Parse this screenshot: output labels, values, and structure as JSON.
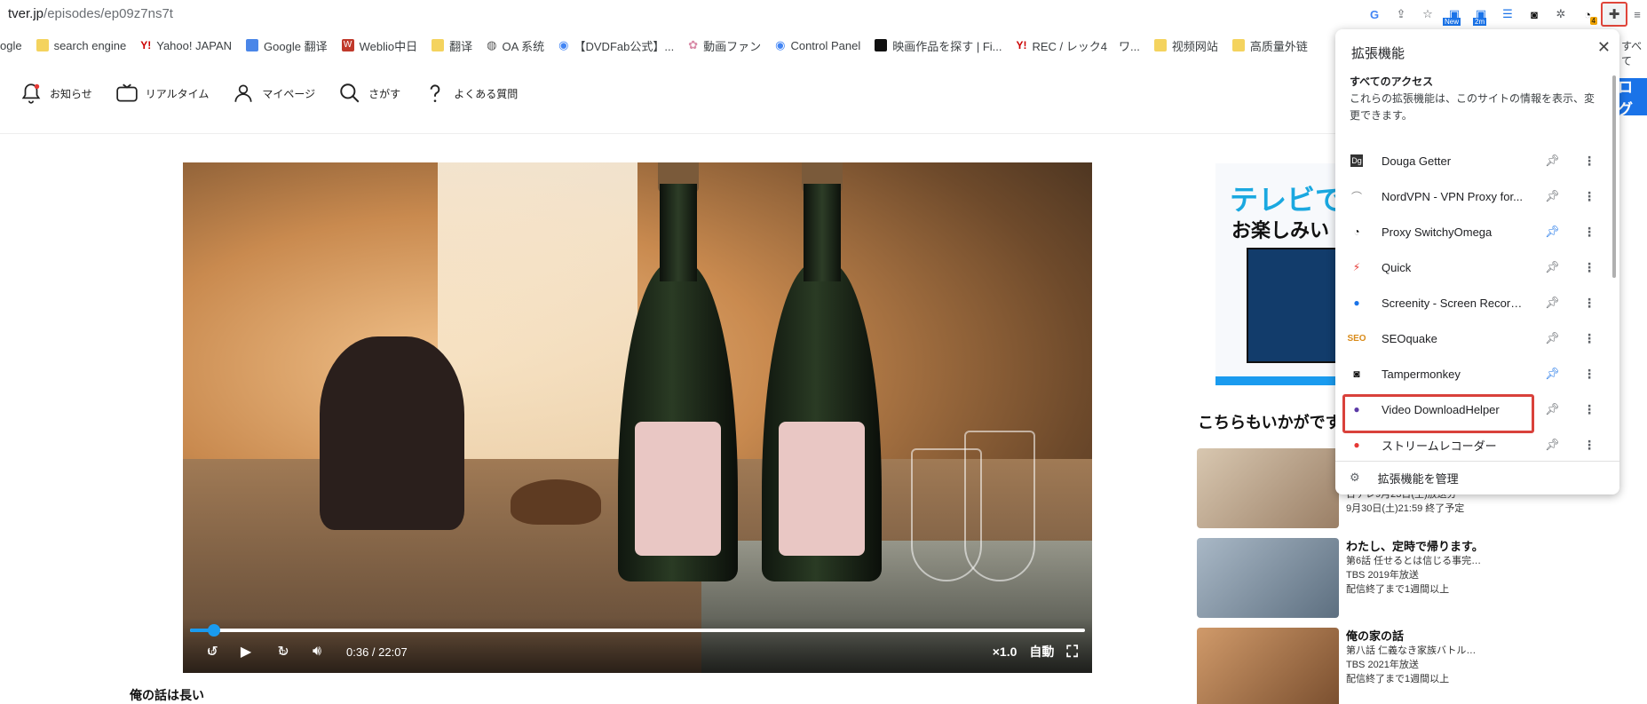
{
  "browser": {
    "url_host": "tver.jp",
    "url_path": "/episodes/ep09z7ns7t",
    "bookmarks": [
      {
        "label": "ogle",
        "icon": "partial"
      },
      {
        "label": "search engine",
        "icon": "folder-icon"
      },
      {
        "label": "Yahoo! JAPAN",
        "icon": "yahoo-icon"
      },
      {
        "label": "Google 翻译",
        "icon": "translate-icon"
      },
      {
        "label": "Weblio中日",
        "icon": "weblio-icon"
      },
      {
        "label": "翻译",
        "icon": "folder-icon"
      },
      {
        "label": "OA 系统",
        "icon": "globe-icon"
      },
      {
        "label": "【DVDFab公式】...",
        "icon": "chrome-icon"
      },
      {
        "label": "動画ファン",
        "icon": "flower-icon"
      },
      {
        "label": "Control Panel",
        "icon": "chrome-icon"
      },
      {
        "label": "映画作品を探す | Fi...",
        "icon": "film-icon"
      },
      {
        "label": "REC / レック4　ワ...",
        "icon": "yahoo-icon"
      },
      {
        "label": "视频网站",
        "icon": "folder-icon"
      },
      {
        "label": "高质量外链",
        "icon": "folder-icon"
      }
    ],
    "bookmarks_overflow": "すべて",
    "toolbar_badges": {
      "new": "New",
      "two_m": "2m",
      "count": "4"
    }
  },
  "site": {
    "nav": [
      {
        "label": "お知らせ",
        "icon": "bell-icon"
      },
      {
        "label": "リアルタイム",
        "icon": "tv-icon"
      },
      {
        "label": "マイページ",
        "icon": "user-icon"
      },
      {
        "label": "さがす",
        "icon": "search-icon"
      },
      {
        "label": "よくある質問",
        "icon": "question-icon"
      }
    ],
    "login_label": "ログ"
  },
  "player": {
    "current_time": "0:36",
    "duration": "22:07",
    "time_sep": " / ",
    "progress": 0.027,
    "speed": "×1.0",
    "quality": "自動",
    "skip_back": "10",
    "skip_fwd": "10"
  },
  "episode_title": "俺の話は長い",
  "ad": {
    "line1": "テレビで",
    "line2": "お楽しみい"
  },
  "recommend": {
    "heading": "こちらもいかがです",
    "items": [
      {
        "title": "",
        "lines": [
          "日テレ9月23日(土)放送分",
          "9月30日(土)21:59 終了予定"
        ],
        "thumb": "#c9b39a"
      },
      {
        "title": "わたし、定時で帰ります。",
        "lines": [
          "第6話 任せるとは信じる事完…",
          "TBS 2019年放送",
          "配信終了まで1週間以上"
        ],
        "thumb": "#8aa0b2"
      },
      {
        "title": "俺の家の話",
        "lines": [
          "第八話 仁義なき家族バトル…",
          "TBS 2021年放送",
          "配信終了まで1週間以上"
        ],
        "thumb": "#b7825a"
      }
    ]
  },
  "extensions": {
    "title": "拡張機能",
    "sub": "すべてのアクセス",
    "desc": "これらの拡張機能は、このサイトの情報を表示、変更できます。",
    "items": [
      {
        "name": "Douga Getter",
        "icon": "douga-icon",
        "pinned": false
      },
      {
        "name": "NordVPN - VPN Proxy for...",
        "icon": "nordvpn-icon",
        "pinned": false
      },
      {
        "name": "Proxy SwitchyOmega",
        "icon": "switchyomega-icon",
        "pinned": true
      },
      {
        "name": "Quick",
        "icon": "bolt-icon",
        "pinned": false
      },
      {
        "name": "Screenity - Screen Record...",
        "icon": "screenity-icon",
        "pinned": false
      },
      {
        "name": "SEOquake",
        "icon": "seoquake-icon",
        "pinned": false
      },
      {
        "name": "Tampermonkey",
        "icon": "tampermonkey-icon",
        "pinned": true
      },
      {
        "name": "Video DownloadHelper",
        "icon": "vdh-icon",
        "pinned": false,
        "highlighted": true
      },
      {
        "name": "ストリームレコーダー",
        "icon": "record-icon",
        "pinned": false
      }
    ],
    "manage_label": "拡張機能を管理"
  },
  "colors": {
    "accent": "#1a9bef",
    "highlight": "#d9413b",
    "pin_on": "#1a73e8"
  }
}
